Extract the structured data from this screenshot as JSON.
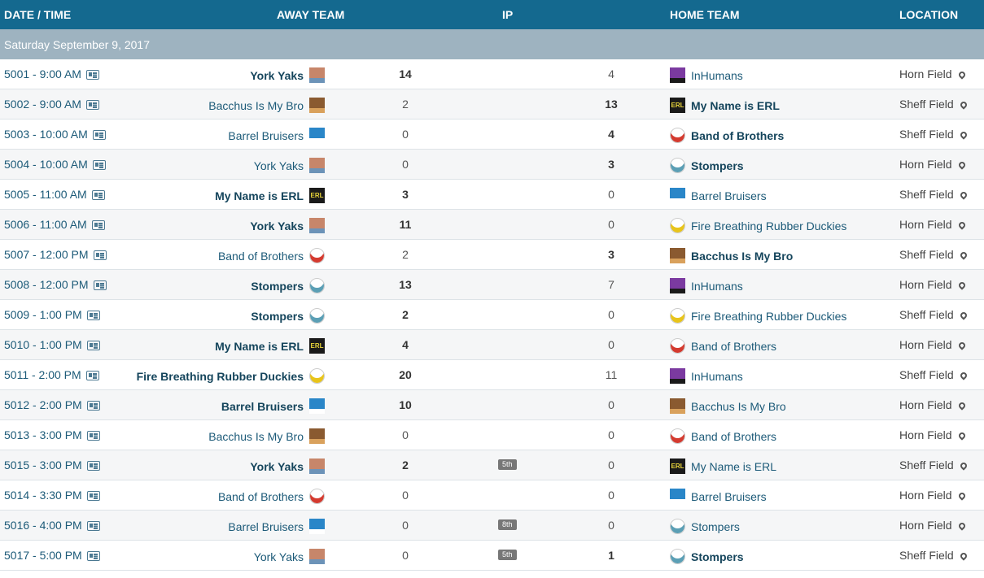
{
  "header": {
    "date_time": "DATE / TIME",
    "away_team": "AWAY TEAM",
    "ip": "IP",
    "home_team": "HOME TEAM",
    "location": "LOCATION"
  },
  "date_group": "Saturday September 9, 2017",
  "colors": {
    "header_bg": "#14698f",
    "date_band_bg": "#9eb3c0",
    "link_text": "#1c5a78"
  },
  "teams": {
    "York Yaks": {
      "logo_bg": "#c7866a",
      "logo_accent": "#6c93b8",
      "logo_text": ""
    },
    "InHumans": {
      "logo_bg": "#7b3aa0",
      "logo_accent": "#1a1a1a",
      "logo_text": ""
    },
    "Bacchus Is My Bro": {
      "logo_bg": "#8a5a30",
      "logo_accent": "#d9a15c",
      "logo_text": ""
    },
    "My Name is ERL": {
      "logo_bg": "#1a1a1a",
      "logo_accent": "#e8d43a",
      "logo_text": "ERL"
    },
    "Barrel Bruisers": {
      "logo_bg": "#2a86c8",
      "logo_accent": "#ffffff",
      "logo_text": ""
    },
    "Band of Brothers": {
      "logo_bg": "#ffffff",
      "logo_accent": "#d43a2f",
      "logo_text": ""
    },
    "Stompers": {
      "logo_bg": "#ffffff",
      "logo_accent": "#5b9fb5",
      "logo_text": ""
    },
    "Fire Breathing Rubber Duckies": {
      "logo_bg": "#ffffff",
      "logo_accent": "#e8c41a",
      "logo_text": ""
    }
  },
  "games": [
    {
      "id_time": "5001 - 9:00 AM",
      "away": "York Yaks",
      "away_score": "14",
      "ip": "",
      "home_score": "4",
      "home": "InHumans",
      "location": "Horn Field",
      "winner": "away"
    },
    {
      "id_time": "5002 - 9:00 AM",
      "away": "Bacchus Is My Bro",
      "away_score": "2",
      "ip": "",
      "home_score": "13",
      "home": "My Name is ERL",
      "location": "Sheff Field",
      "winner": "home"
    },
    {
      "id_time": "5003 - 10:00 AM",
      "away": "Barrel Bruisers",
      "away_score": "0",
      "ip": "",
      "home_score": "4",
      "home": "Band of Brothers",
      "location": "Sheff Field",
      "winner": "home"
    },
    {
      "id_time": "5004 - 10:00 AM",
      "away": "York Yaks",
      "away_score": "0",
      "ip": "",
      "home_score": "3",
      "home": "Stompers",
      "location": "Horn Field",
      "winner": "home"
    },
    {
      "id_time": "5005 - 11:00 AM",
      "away": "My Name is ERL",
      "away_score": "3",
      "ip": "",
      "home_score": "0",
      "home": "Barrel Bruisers",
      "location": "Sheff Field",
      "winner": "away"
    },
    {
      "id_time": "5006 - 11:00 AM",
      "away": "York Yaks",
      "away_score": "11",
      "ip": "",
      "home_score": "0",
      "home": "Fire Breathing Rubber Duckies",
      "location": "Horn Field",
      "winner": "away"
    },
    {
      "id_time": "5007 - 12:00 PM",
      "away": "Band of Brothers",
      "away_score": "2",
      "ip": "",
      "home_score": "3",
      "home": "Bacchus Is My Bro",
      "location": "Sheff Field",
      "winner": "home"
    },
    {
      "id_time": "5008 - 12:00 PM",
      "away": "Stompers",
      "away_score": "13",
      "ip": "",
      "home_score": "7",
      "home": "InHumans",
      "location": "Horn Field",
      "winner": "away"
    },
    {
      "id_time": "5009 - 1:00 PM",
      "away": "Stompers",
      "away_score": "2",
      "ip": "",
      "home_score": "0",
      "home": "Fire Breathing Rubber Duckies",
      "location": "Sheff Field",
      "winner": "away"
    },
    {
      "id_time": "5010 - 1:00 PM",
      "away": "My Name is ERL",
      "away_score": "4",
      "ip": "",
      "home_score": "0",
      "home": "Band of Brothers",
      "location": "Horn Field",
      "winner": "away"
    },
    {
      "id_time": "5011 - 2:00 PM",
      "away": "Fire Breathing Rubber Duckies",
      "away_score": "20",
      "ip": "",
      "home_score": "11",
      "home": "InHumans",
      "location": "Sheff Field",
      "winner": "away"
    },
    {
      "id_time": "5012 - 2:00 PM",
      "away": "Barrel Bruisers",
      "away_score": "10",
      "ip": "",
      "home_score": "0",
      "home": "Bacchus Is My Bro",
      "location": "Horn Field",
      "winner": "away"
    },
    {
      "id_time": "5013 - 3:00 PM",
      "away": "Bacchus Is My Bro",
      "away_score": "0",
      "ip": "",
      "home_score": "0",
      "home": "Band of Brothers",
      "location": "Horn Field",
      "winner": "none"
    },
    {
      "id_time": "5015 - 3:00 PM",
      "away": "York Yaks",
      "away_score": "2",
      "ip": "5th",
      "home_score": "0",
      "home": "My Name is ERL",
      "location": "Sheff Field",
      "winner": "away"
    },
    {
      "id_time": "5014 - 3:30 PM",
      "away": "Band of Brothers",
      "away_score": "0",
      "ip": "",
      "home_score": "0",
      "home": "Barrel Bruisers",
      "location": "Horn Field",
      "winner": "none"
    },
    {
      "id_time": "5016 - 4:00 PM",
      "away": "Barrel Bruisers",
      "away_score": "0",
      "ip": "8th",
      "home_score": "0",
      "home": "Stompers",
      "location": "Horn Field",
      "winner": "none"
    },
    {
      "id_time": "5017 - 5:00 PM",
      "away": "York Yaks",
      "away_score": "0",
      "ip": "5th",
      "home_score": "1",
      "home": "Stompers",
      "location": "Sheff Field",
      "winner": "home"
    }
  ]
}
